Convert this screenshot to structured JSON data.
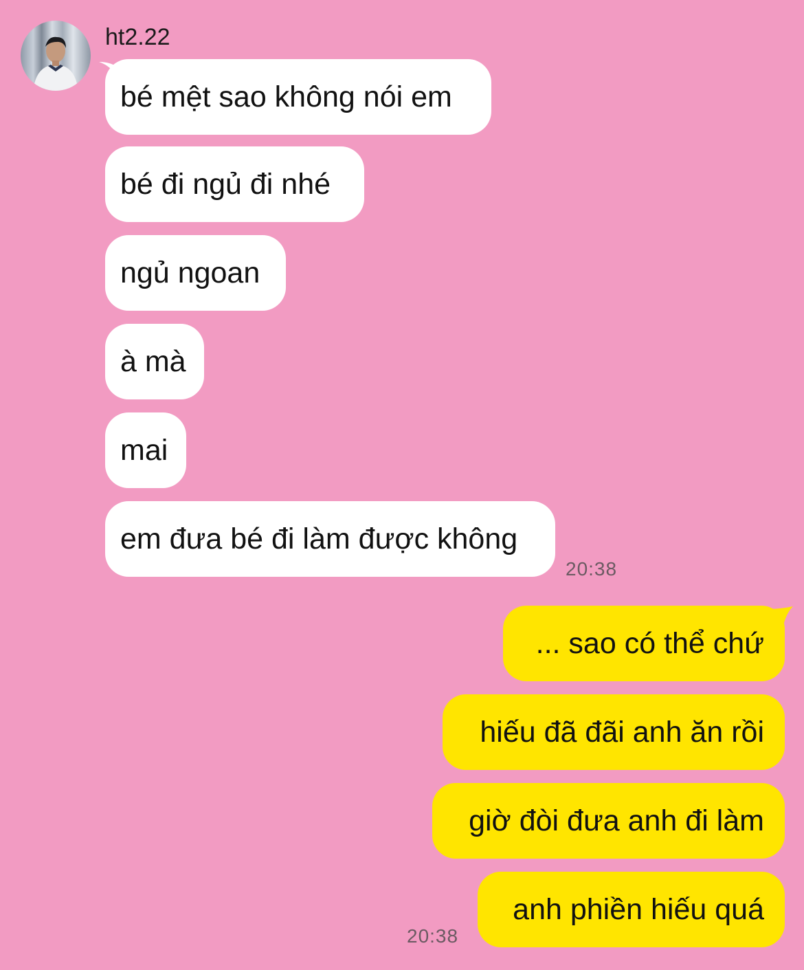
{
  "contact": {
    "name": "ht2.22"
  },
  "incoming": [
    "bé mệt sao không nói em",
    "bé đi ngủ đi nhé",
    "ngủ ngoan",
    "à mà",
    "mai",
    "em đưa bé đi làm được không"
  ],
  "incoming_time": "20:38",
  "outgoing": [
    "... sao có thể chứ",
    "hiếu đã đãi anh ăn rồi",
    "giờ đòi đưa anh đi làm",
    "anh phiền hiếu quá"
  ],
  "outgoing_time": "20:38",
  "colors": {
    "background": "#f29bc2",
    "incoming_bubble": "#ffffff",
    "outgoing_bubble": "#ffe500"
  }
}
